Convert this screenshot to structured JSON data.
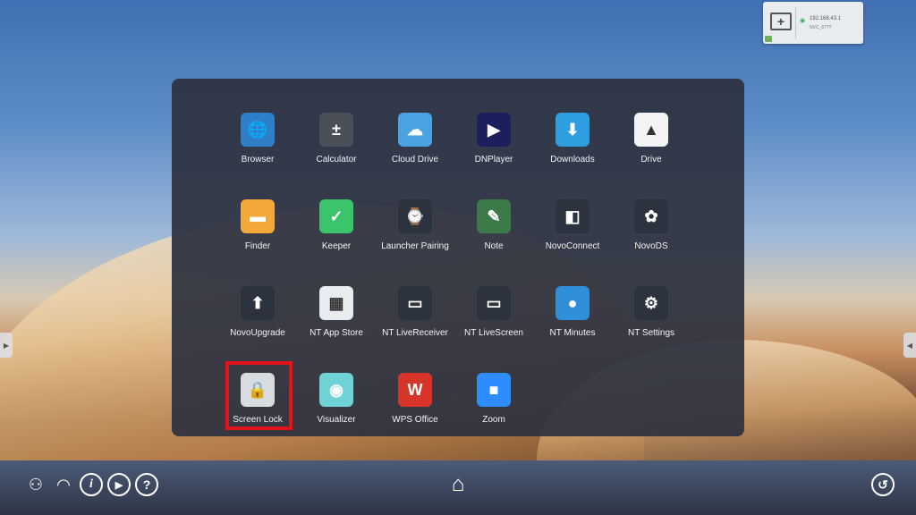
{
  "connect_card": {
    "ip": "192.168.43.1",
    "ssid": "NVC_6???",
    "add_glyph": "+"
  },
  "apps": [
    {
      "label": "Browser",
      "icon": "globe-icon",
      "color": "#2f7ec8",
      "glyph": "🌐"
    },
    {
      "label": "Calculator",
      "icon": "calculator-icon",
      "color": "#4a4f58",
      "glyph": "±"
    },
    {
      "label": "Cloud Drive",
      "icon": "cloud-upload-icon",
      "color": "#4aa3e0",
      "glyph": "☁"
    },
    {
      "label": "DNPlayer",
      "icon": "play-disc-icon",
      "color": "#1b1f5c",
      "glyph": "▶"
    },
    {
      "label": "Downloads",
      "icon": "download-icon",
      "color": "#2f9ee0",
      "glyph": "⬇"
    },
    {
      "label": "Drive",
      "icon": "drive-icon",
      "color": "#f4f4f4",
      "glyph": "▲"
    },
    {
      "label": "Finder",
      "icon": "folder-icon",
      "color": "#f3a93a",
      "glyph": "▬"
    },
    {
      "label": "Keeper",
      "icon": "keeper-icon",
      "color": "#3cc46a",
      "glyph": "✓"
    },
    {
      "label": "Launcher Pairing",
      "icon": "remote-pairing-icon",
      "color": "#2d323f",
      "glyph": "⌚"
    },
    {
      "label": "Note",
      "icon": "chalkboard-icon",
      "color": "#3d7a4a",
      "glyph": "✎"
    },
    {
      "label": "NovoConnect",
      "icon": "novoconnect-icon",
      "color": "#2d323f",
      "glyph": "◧"
    },
    {
      "label": "NovoDS",
      "icon": "novods-icon",
      "color": "#2d323f",
      "glyph": "✿"
    },
    {
      "label": "NovoUpgrade",
      "icon": "upgrade-icon",
      "color": "#2d323f",
      "glyph": "⬆"
    },
    {
      "label": "NT App Store",
      "icon": "app-store-icon",
      "color": "#e9ecef",
      "glyph": "▦"
    },
    {
      "label": "NT LiveReceiver",
      "icon": "live-receiver-icon",
      "color": "#2d323f",
      "glyph": "▭"
    },
    {
      "label": "NT LiveScreen",
      "icon": "live-screen-icon",
      "color": "#2d323f",
      "glyph": "▭"
    },
    {
      "label": "NT Minutes",
      "icon": "record-icon",
      "color": "#2f8fd8",
      "glyph": "●"
    },
    {
      "label": "NT Settings",
      "icon": "settings-gear-icon",
      "color": "#2d323f",
      "glyph": "⚙"
    },
    {
      "label": "Screen Lock",
      "icon": "padlock-icon",
      "color": "#d9dcdf",
      "glyph": "🔒"
    },
    {
      "label": "Visualizer",
      "icon": "camera-lens-icon",
      "color": "#6fd3d6",
      "glyph": "◉"
    },
    {
      "label": "WPS Office",
      "icon": "wps-office-icon",
      "color": "#d8352a",
      "glyph": "W"
    },
    {
      "label": "Zoom",
      "icon": "zoom-video-icon",
      "color": "#2d8cff",
      "glyph": "■"
    }
  ],
  "bottom_bar": {
    "network_glyph": "⚇",
    "wifi_glyph": "◠",
    "info_glyph": "i",
    "play_glyph": "▶",
    "help_glyph": "?",
    "home_glyph": "⌂",
    "history_glyph": "↺"
  },
  "side_tabs": {
    "left_glyph": "▶",
    "right_glyph": "◀"
  }
}
